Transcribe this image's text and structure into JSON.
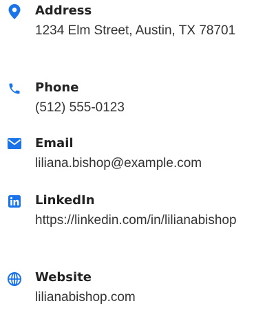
{
  "accent_color": "#1a73e8",
  "contacts": [
    {
      "icon": "map-pin-icon",
      "label": "Address",
      "value": "1234 Elm Street, Austin, TX 78701"
    },
    {
      "icon": "phone-icon",
      "label": "Phone",
      "value": "(512) 555-0123"
    },
    {
      "icon": "envelope-icon",
      "label": "Email",
      "value": "liliana.bishop@example.com"
    },
    {
      "icon": "linkedin-icon",
      "label": "LinkedIn",
      "value": "https://linkedin.com/in/lilianabishop"
    },
    {
      "icon": "globe-icon",
      "label": "Website",
      "value": "lilianabishop.com"
    }
  ]
}
